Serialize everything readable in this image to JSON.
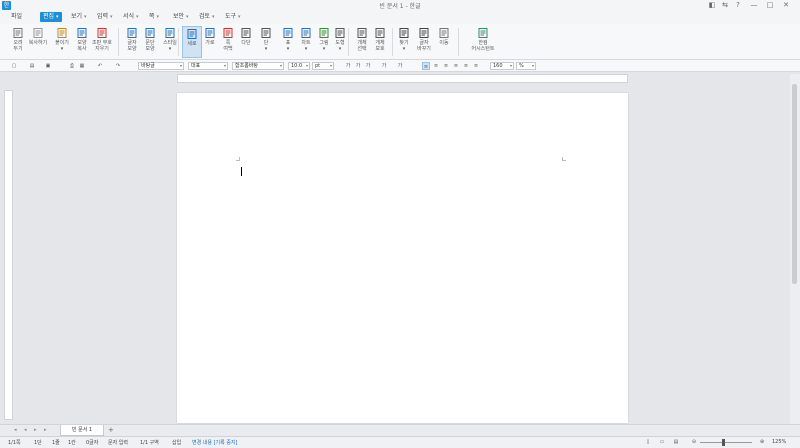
{
  "window": {
    "title": "빈 문서 1 - 한글",
    "controls": [
      "◧",
      "⇆",
      "?",
      "—",
      "□",
      "✕"
    ]
  },
  "menu": {
    "items": [
      {
        "label": "파일",
        "active": false
      },
      {
        "label": "편집",
        "active": true
      },
      {
        "label": "보기",
        "active": false
      },
      {
        "label": "입력",
        "active": false
      },
      {
        "label": "서식",
        "active": false
      },
      {
        "label": "쪽",
        "active": false
      },
      {
        "label": "보안",
        "active": false
      },
      {
        "label": "검토",
        "active": false
      },
      {
        "label": "도구",
        "active": false
      }
    ]
  },
  "ribbon": {
    "buttons": [
      {
        "id": "cut",
        "icon": "scissors-icon",
        "l1": "오려",
        "l2": "두기"
      },
      {
        "id": "copy",
        "icon": "copy-icon",
        "l1": "복사하기",
        "l2": ""
      },
      {
        "id": "paste",
        "icon": "paste-icon",
        "l1": "붙이기",
        "l2": "▾"
      },
      {
        "id": "format-copy",
        "icon": "format-painter-icon",
        "l1": "모양",
        "l2": "복사"
      },
      {
        "id": "clear-format",
        "icon": "clear-format-icon",
        "l1": "조판 부호",
        "l2": "지우기"
      },
      {
        "id": "char-shape",
        "icon": "char-shape-icon",
        "l1": "글자",
        "l2": "모양"
      },
      {
        "id": "para-shape",
        "icon": "para-shape-icon",
        "l1": "문단",
        "l2": "모양"
      },
      {
        "id": "style",
        "icon": "style-icon",
        "l1": "스타일",
        "l2": "▾"
      },
      {
        "id": "vertical",
        "icon": "vertical-layout-icon",
        "l1": "세로",
        "l2": ""
      },
      {
        "id": "horizontal",
        "icon": "horizontal-layout-icon",
        "l1": "가로",
        "l2": ""
      },
      {
        "id": "margin",
        "icon": "page-margin-icon",
        "l1": "쪽",
        "l2": "여백"
      },
      {
        "id": "columns",
        "icon": "columns-icon",
        "l1": "다단",
        "l2": ""
      },
      {
        "id": "numbering",
        "icon": "numbering-icon",
        "l1": "단",
        "l2": "▾"
      },
      {
        "id": "table",
        "icon": "table-icon",
        "l1": "표",
        "l2": "▾"
      },
      {
        "id": "chart",
        "icon": "chart-icon",
        "l1": "차트",
        "l2": "▾"
      },
      {
        "id": "image",
        "icon": "image-icon",
        "l1": "그림",
        "l2": "▾"
      },
      {
        "id": "shape",
        "icon": "shape-icon",
        "l1": "도형",
        "l2": "▾"
      },
      {
        "id": "select-obj",
        "icon": "select-object-icon",
        "l1": "개체",
        "l2": "선택"
      },
      {
        "id": "arrange-obj",
        "icon": "arrange-object-icon",
        "l1": "개체",
        "l2": "보호"
      },
      {
        "id": "find",
        "icon": "binoculars-icon",
        "l1": "찾기",
        "l2": "▾"
      },
      {
        "id": "replace",
        "icon": "replace-icon",
        "l1": "글자",
        "l2": "바꾸기"
      },
      {
        "id": "goto",
        "icon": "goto-icon",
        "l1": "이동",
        "l2": ""
      },
      {
        "id": "search-ai",
        "icon": "search-person-icon",
        "l1": "한컴",
        "l2": "어시스턴트"
      }
    ]
  },
  "format": {
    "style": "바탕글",
    "lang": "대표",
    "font": "함초롬바탕",
    "size": "10.0",
    "unit": "pt",
    "zoom": "160",
    "percent": "%"
  },
  "document": {
    "tab_label": "빈 문서 1",
    "tab_add": "+"
  },
  "status": {
    "items": [
      "1/1쪽",
      "1단",
      "1줄",
      "1칸",
      "0글자",
      "문자 입력",
      "1/1 구역",
      "삽입",
      "변경 내용 [기록 중지]"
    ],
    "zoom": "125%"
  }
}
